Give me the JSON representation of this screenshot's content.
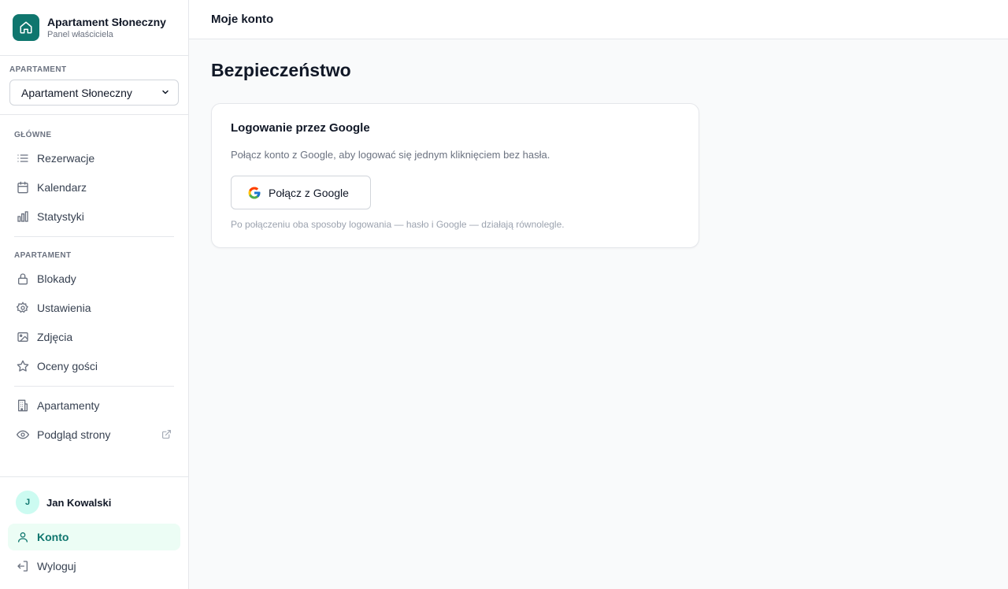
{
  "brand": {
    "name": "Apartament Słoneczny",
    "subtitle": "Panel właściciela"
  },
  "apartment_picker": {
    "label": "APARTAMENT",
    "selected": "Apartament Słoneczny"
  },
  "nav": {
    "section_main": "GŁÓWNE",
    "main_items": [
      {
        "label": "Rezerwacje",
        "icon": "list-icon"
      },
      {
        "label": "Kalendarz",
        "icon": "calendar-icon"
      },
      {
        "label": "Statystyki",
        "icon": "bar-chart-icon"
      }
    ],
    "section_apartment": "APARTAMENT",
    "apartment_items": [
      {
        "label": "Blokady",
        "icon": "lock-icon"
      },
      {
        "label": "Ustawienia",
        "icon": "gear-icon"
      },
      {
        "label": "Zdjęcia",
        "icon": "image-icon"
      },
      {
        "label": "Oceny gości",
        "icon": "star-icon"
      }
    ],
    "other_items": [
      {
        "label": "Apartamenty",
        "icon": "building-icon"
      },
      {
        "label": "Podgląd strony",
        "icon": "eye-icon"
      }
    ]
  },
  "user": {
    "initial": "J",
    "name": "Jan Kowalski"
  },
  "account_nav": [
    {
      "label": "Konto",
      "icon": "user-icon",
      "active": true
    },
    {
      "label": "Wyloguj",
      "icon": "logout-icon",
      "active": false
    }
  ],
  "topbar": {
    "title": "Moje konto"
  },
  "page": {
    "title": "Bezpieczeństwo",
    "card": {
      "title": "Logowanie przez Google",
      "description": "Połącz konto z Google, aby logować się jednym kliknięciem bez hasła.",
      "button_label": "Połącz z Google",
      "note": "Po połączeniu oba sposoby logowania — hasło i Google — działają równolegle."
    }
  },
  "colors": {
    "accent": "#0f766e",
    "active_bg": "#ecfdf5"
  }
}
